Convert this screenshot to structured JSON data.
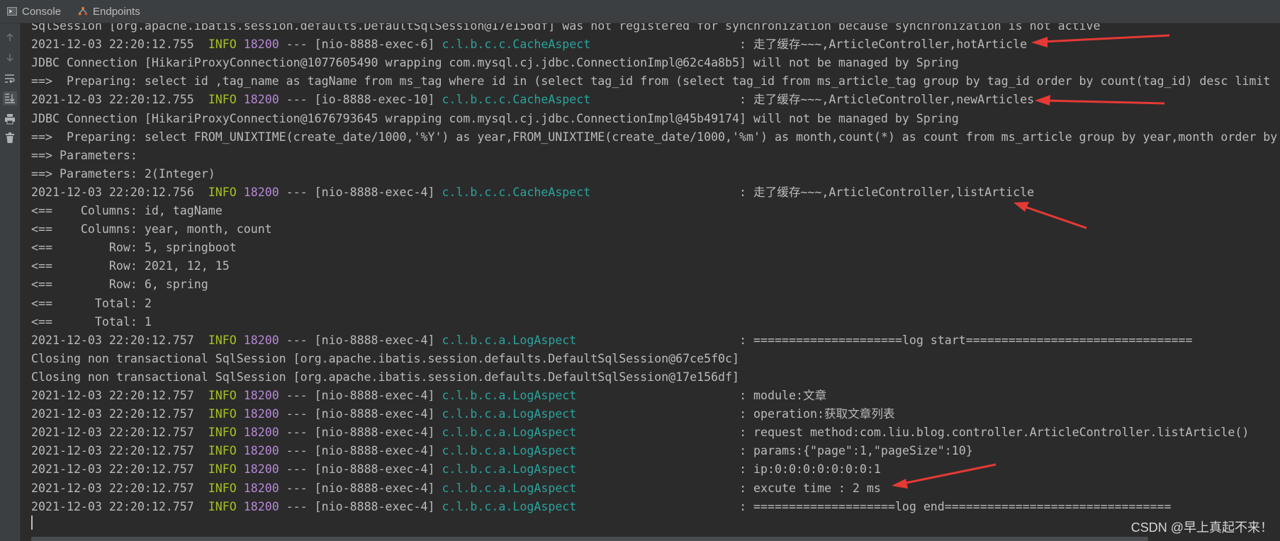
{
  "tabs": [
    {
      "label": "Console",
      "icon": "console-icon"
    },
    {
      "label": "Endpoints",
      "icon": "endpoints-icon"
    }
  ],
  "toolbar": [
    {
      "icon": "scroll-up-icon"
    },
    {
      "icon": "scroll-down-icon"
    },
    {
      "icon": "soft-wrap-icon"
    },
    {
      "icon": "scroll-to-end-icon"
    },
    {
      "icon": "print-icon"
    },
    {
      "icon": "clear-all-icon"
    }
  ],
  "log_lines": [
    {
      "text": "SqlSession [org.apache.ibatis.session.defaults.DefaultSqlSession@17e156df] was not registered for synchronization because synchronization is not active"
    },
    {
      "ts": "2021-12-03 22:20:12.755",
      "level": "INFO",
      "pid": "18200",
      "thread": " --- [nio-8888-exec-6] ",
      "cls": "c.l.b.c.c.CacheAspect",
      "msg": "                     : 走了缓存~~~,ArticleController,hotArticle"
    },
    {
      "text": "JDBC Connection [HikariProxyConnection@1077605490 wrapping com.mysql.cj.jdbc.ConnectionImpl@62c4a8b5] will not be managed by Spring"
    },
    {
      "text": "==>  Preparing: select id ,tag_name as tagName from ms_tag where id in (select tag_id from (select tag_id from ms_article_tag group by tag_id order by count(tag_id) desc limit"
    },
    {
      "ts": "2021-12-03 22:20:12.755",
      "level": "INFO",
      "pid": "18200",
      "thread": " --- [io-8888-exec-10] ",
      "cls": "c.l.b.c.c.CacheAspect",
      "msg": "                     : 走了缓存~~~,ArticleController,newArticles"
    },
    {
      "text": "JDBC Connection [HikariProxyConnection@1676793645 wrapping com.mysql.cj.jdbc.ConnectionImpl@45b49174] will not be managed by Spring"
    },
    {
      "text": "==>  Preparing: select FROM_UNIXTIME(create_date/1000,'%Y') as year,FROM_UNIXTIME(create_date/1000,'%m') as month,count(*) as count from ms_article group by year,month order by"
    },
    {
      "text": "==> Parameters: "
    },
    {
      "text": "==> Parameters: 2(Integer)"
    },
    {
      "ts": "2021-12-03 22:20:12.756",
      "level": "INFO",
      "pid": "18200",
      "thread": " --- [nio-8888-exec-4] ",
      "cls": "c.l.b.c.c.CacheAspect",
      "msg": "                     : 走了缓存~~~,ArticleController,listArticle"
    },
    {
      "text": "<==    Columns: id, tagName"
    },
    {
      "text": "<==    Columns: year, month, count"
    },
    {
      "text": "<==        Row: 5, springboot"
    },
    {
      "text": "<==        Row: 2021, 12, 15"
    },
    {
      "text": "<==        Row: 6, spring"
    },
    {
      "text": "<==      Total: 2"
    },
    {
      "text": "<==      Total: 1"
    },
    {
      "ts": "2021-12-03 22:20:12.757",
      "level": "INFO",
      "pid": "18200",
      "thread": " --- [nio-8888-exec-4] ",
      "cls": "c.l.b.c.a.LogAspect",
      "msg": "                       : =====================log start================================"
    },
    {
      "text": "Closing non transactional SqlSession [org.apache.ibatis.session.defaults.DefaultSqlSession@67ce5f0c]"
    },
    {
      "text": "Closing non transactional SqlSession [org.apache.ibatis.session.defaults.DefaultSqlSession@17e156df]"
    },
    {
      "ts": "2021-12-03 22:20:12.757",
      "level": "INFO",
      "pid": "18200",
      "thread": " --- [nio-8888-exec-4] ",
      "cls": "c.l.b.c.a.LogAspect",
      "msg": "                       : module:文章"
    },
    {
      "ts": "2021-12-03 22:20:12.757",
      "level": "INFO",
      "pid": "18200",
      "thread": " --- [nio-8888-exec-4] ",
      "cls": "c.l.b.c.a.LogAspect",
      "msg": "                       : operation:获取文章列表"
    },
    {
      "ts": "2021-12-03 22:20:12.757",
      "level": "INFO",
      "pid": "18200",
      "thread": " --- [nio-8888-exec-4] ",
      "cls": "c.l.b.c.a.LogAspect",
      "msg": "                       : request method:com.liu.blog.controller.ArticleController.listArticle()"
    },
    {
      "ts": "2021-12-03 22:20:12.757",
      "level": "INFO",
      "pid": "18200",
      "thread": " --- [nio-8888-exec-4] ",
      "cls": "c.l.b.c.a.LogAspect",
      "msg": "                       : params:{\"page\":1,\"pageSize\":10}"
    },
    {
      "ts": "2021-12-03 22:20:12.757",
      "level": "INFO",
      "pid": "18200",
      "thread": " --- [nio-8888-exec-4] ",
      "cls": "c.l.b.c.a.LogAspect",
      "msg": "                       : ip:0:0:0:0:0:0:0:1"
    },
    {
      "ts": "2021-12-03 22:20:12.757",
      "level": "INFO",
      "pid": "18200",
      "thread": " --- [nio-8888-exec-4] ",
      "cls": "c.l.b.c.a.LogAspect",
      "msg": "                       : excute time : 2 ms"
    },
    {
      "ts": "2021-12-03 22:20:12.757",
      "level": "INFO",
      "pid": "18200",
      "thread": " --- [nio-8888-exec-4] ",
      "cls": "c.l.b.c.a.LogAspect",
      "msg": "                       : ====================log end================================"
    }
  ],
  "watermark": "CSDN @早上真起不来！",
  "colors": {
    "background": "#2b2b2b",
    "text": "#bbbbbb",
    "info": "#a8c023",
    "pid": "#b589d6",
    "logger": "#2aa39c",
    "annotation_arrow": "#e53935"
  }
}
